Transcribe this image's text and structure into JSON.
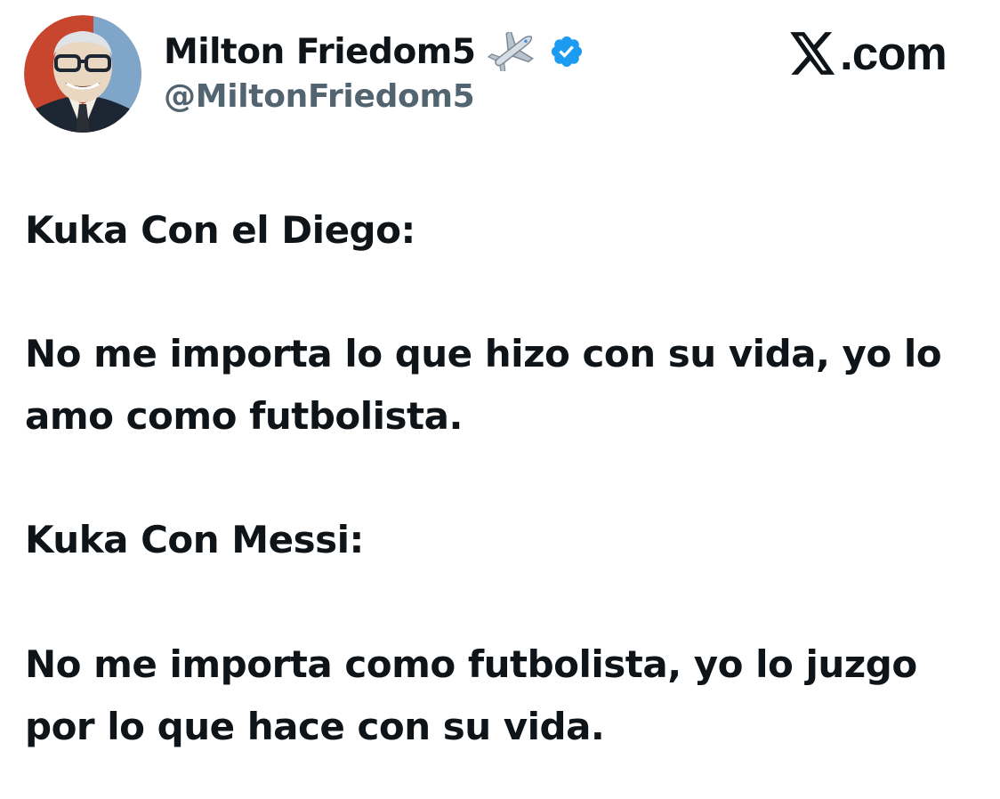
{
  "author": {
    "display_name": "Milton Friedom5",
    "name_emoji": "airplane-emoji",
    "verified_icon": "verified-badge-icon",
    "handle": "@MiltonFriedom5"
  },
  "brand": {
    "icon": "x-logo-icon",
    "text": ".com"
  },
  "tweet": {
    "lines": [
      "Kuka Con el Diego:",
      "No me importa lo que hizo con su vida, yo lo",
      "amo como futbolista.",
      "Kuka Con Messi:",
      "No me importa como futbolista, yo lo juzgo",
      "por lo que hace con su vida."
    ]
  },
  "colors": {
    "text": "#0f1419",
    "handle": "#536471",
    "verified": "#1d9bf0",
    "background": "#ffffff"
  }
}
